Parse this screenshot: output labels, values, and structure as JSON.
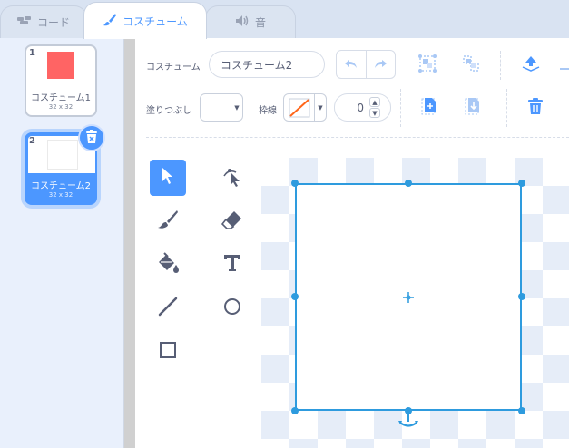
{
  "tabs": [
    {
      "label": "コード",
      "icon": "code-icon"
    },
    {
      "label": "コスチューム",
      "icon": "paintbrush-icon"
    },
    {
      "label": "音",
      "icon": "speaker-icon"
    }
  ],
  "costumes": [
    {
      "number": "1",
      "name": "コスチューム1",
      "size": "32 x 32",
      "thumb_color": "#ff6464"
    },
    {
      "number": "2",
      "name": "コスチューム2",
      "size": "32 x 32",
      "thumb_color": "#ffffff",
      "selected": true
    }
  ],
  "toolbar": {
    "costume_label": "コスチューム",
    "costume_name": "コスチューム2",
    "fill_label": "塗りつぶし",
    "outline_label": "枠線",
    "outline_width": "0"
  },
  "tools": [
    "select-icon",
    "reshape-icon",
    "brush-icon",
    "eraser-icon",
    "fill-icon",
    "text-icon",
    "line-icon",
    "circle-icon",
    "rectangle-icon"
  ],
  "colors": {
    "accent": "#4c97ff",
    "selection": "#2e9bde",
    "text": "#575e75"
  }
}
